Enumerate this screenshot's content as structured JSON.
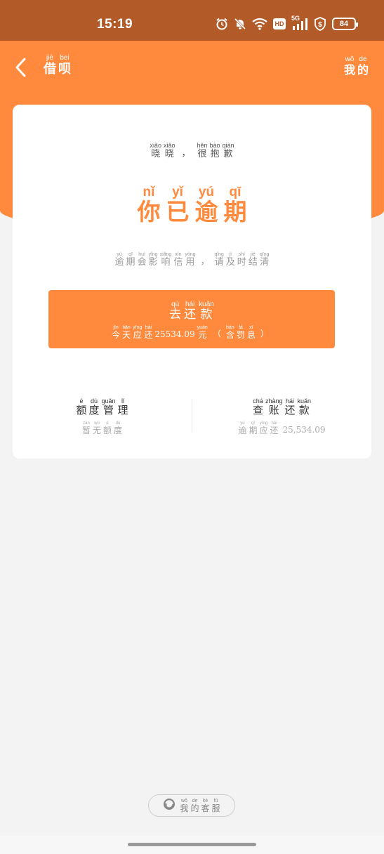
{
  "status_bar": {
    "time": "15:19",
    "battery": "84",
    "icons": [
      "alarm-icon",
      "mute-bell-icon",
      "wifi-icon",
      "hd-icon",
      "5g-signal-icon",
      "security-shield-icon",
      "battery-icon"
    ],
    "hd_label": "HD",
    "net_label": "5G"
  },
  "header": {
    "title": [
      {
        "p": "jiè",
        "c": "借"
      },
      {
        "p": "bei",
        "c": "呗"
      }
    ],
    "mine": [
      {
        "p": "wǒ",
        "c": "我"
      },
      {
        "p": "de",
        "c": "的"
      }
    ],
    "bg_color": "#ff8a3d"
  },
  "card": {
    "greeting_a": [
      {
        "p": "xiǎo",
        "c": "晓"
      },
      {
        "p": "xiǎo",
        "c": "晓"
      }
    ],
    "greeting_sep": "，",
    "greeting_b": [
      {
        "p": "hěn",
        "c": "很"
      },
      {
        "p": "bào",
        "c": "抱"
      },
      {
        "p": "qiàn",
        "c": "歉"
      }
    ],
    "headline": [
      {
        "p": "nǐ",
        "c": "你"
      },
      {
        "p": "yǐ",
        "c": "已"
      },
      {
        "p": "yú",
        "c": "逾"
      },
      {
        "p": "qī",
        "c": "期"
      }
    ],
    "warning_a": [
      {
        "p": "yú",
        "c": "逾"
      },
      {
        "p": "qī",
        "c": "期"
      },
      {
        "p": "huì",
        "c": "会"
      },
      {
        "p": "yǐng",
        "c": "影"
      },
      {
        "p": "xiǎng",
        "c": "响"
      },
      {
        "p": "xìn",
        "c": "信"
      },
      {
        "p": "yòng",
        "c": "用"
      }
    ],
    "warning_sep": "，",
    "warning_b": [
      {
        "p": "qǐng",
        "c": "请"
      },
      {
        "p": "jí",
        "c": "及"
      },
      {
        "p": "shí",
        "c": "时"
      },
      {
        "p": "jié",
        "c": "结"
      },
      {
        "p": "qīng",
        "c": "清"
      }
    ],
    "repay_button": {
      "label": [
        {
          "p": "qù",
          "c": "去"
        },
        {
          "p": "hái",
          "c": "还"
        },
        {
          "p": "kuǎn",
          "c": "款"
        }
      ],
      "sub_a": [
        {
          "p": "jīn",
          "c": "今"
        },
        {
          "p": "tiān",
          "c": "天"
        },
        {
          "p": "yīng",
          "c": "应"
        },
        {
          "p": "hái",
          "c": "还"
        }
      ],
      "amount": "25534.09",
      "sub_unit": {
        "p": "yuán",
        "c": "元"
      },
      "paren_open": "（",
      "sub_b": [
        {
          "p": "hán",
          "c": "含"
        },
        {
          "p": "fá",
          "c": "罚"
        },
        {
          "p": "xī",
          "c": "息"
        }
      ],
      "paren_close": "）"
    },
    "quota": {
      "title": [
        {
          "p": "é",
          "c": "额"
        },
        {
          "p": "dù",
          "c": "度"
        },
        {
          "p": "guǎn",
          "c": "管"
        },
        {
          "p": "lǐ",
          "c": "理"
        }
      ],
      "sub": [
        {
          "p": "zàn",
          "c": "暂"
        },
        {
          "p": "wú",
          "c": "无"
        },
        {
          "p": "é",
          "c": "额"
        },
        {
          "p": "dù",
          "c": "度"
        }
      ]
    },
    "bills": {
      "title": [
        {
          "p": "chá",
          "c": "查"
        },
        {
          "p": "zhàng",
          "c": "账"
        },
        {
          "p": "hái",
          "c": "还"
        },
        {
          "p": "kuǎn",
          "c": "款"
        }
      ],
      "sub": [
        {
          "p": "yú",
          "c": "逾"
        },
        {
          "p": "qī",
          "c": "期"
        },
        {
          "p": "yīng",
          "c": "应"
        },
        {
          "p": "hái",
          "c": "还"
        }
      ],
      "amount": "25,534.09"
    }
  },
  "service": {
    "label": [
      {
        "p": "wǒ",
        "c": "我"
      },
      {
        "p": "de",
        "c": "的"
      },
      {
        "p": "kè",
        "c": "客"
      },
      {
        "p": "fú",
        "c": "服"
      }
    ]
  }
}
